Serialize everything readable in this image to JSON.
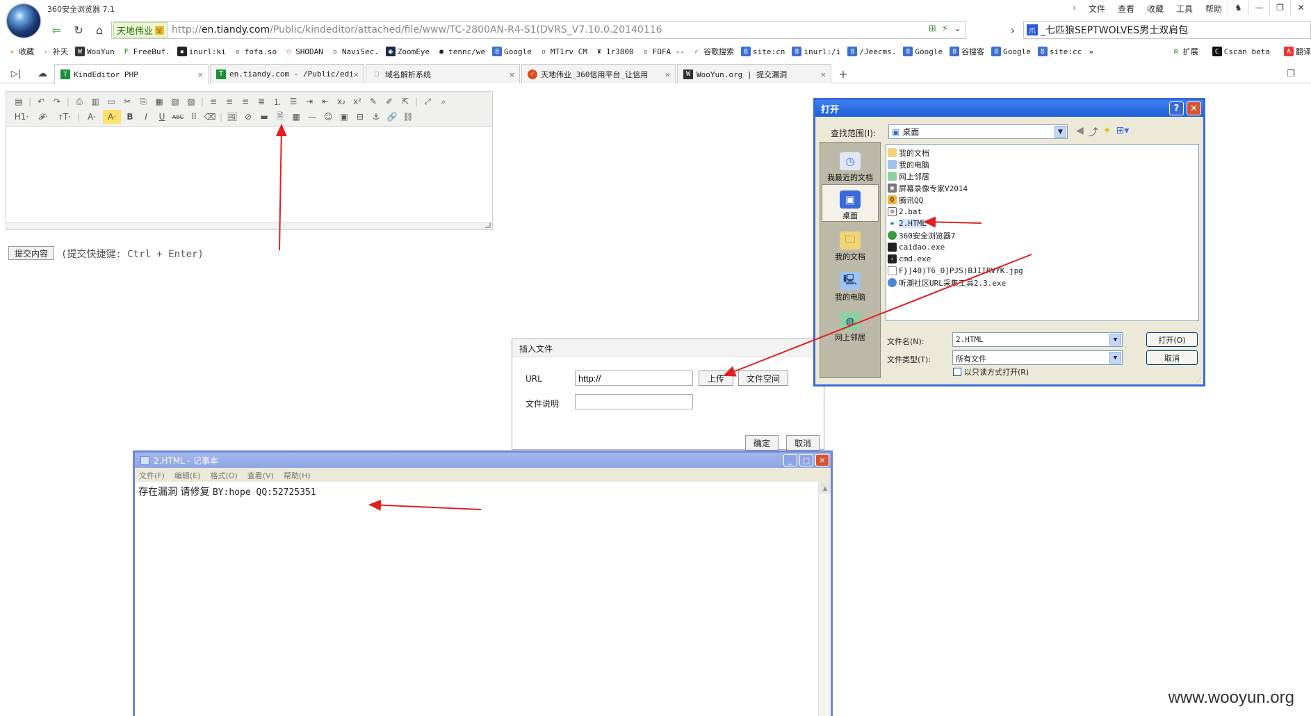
{
  "app": {
    "title": "360安全浏览器 7.1"
  },
  "menu": [
    "文件",
    "查看",
    "收藏",
    "工具",
    "帮助"
  ],
  "nav": {
    "site_badge": "天地伟业",
    "cert_label": "证",
    "url_host": "en.tiandy.com",
    "url_prefix": "http://",
    "url_path": "/Public/kindeditor/attached/file/www/TC-2800AN-R4-S1(DVRS_V7.10.0.20140116",
    "search_text": "_七匹狼SEPTWOLVES男士双肩包"
  },
  "bookmarks": [
    "收藏",
    "补天",
    "WooYun",
    "FreeBuf.",
    "inurl:ki",
    "fofa.so",
    "SHODAN",
    "NaviSec.",
    "ZoomEye",
    "tennc/we",
    "Google",
    "MT1rv CM",
    "1r3800",
    "FOFA --",
    "谷歌搜索",
    "site:cn",
    "inurl:/i",
    "/Jeecms.",
    "Google",
    "谷搜客",
    "Google",
    "site:cc"
  ],
  "bookmarks_right": [
    "扩展",
    "Cscan beta",
    "翻译"
  ],
  "tabs": [
    {
      "label": "KindEditor PHP",
      "icon": "T",
      "color": "#1a8f3a"
    },
    {
      "label": "en.tiandy.com - /Public/edi",
      "icon": "T",
      "color": "#1a8f3a"
    },
    {
      "label": "域名解析系统",
      "icon": "□",
      "color": "#999999"
    },
    {
      "label": "天地伟业_360信用平台_让信用",
      "icon": "✓",
      "color": "#e04b1a"
    },
    {
      "label": "WooYun.org | 提交漏洞",
      "icon": "W",
      "color": "#333333"
    }
  ],
  "editor": {
    "submit_label": "提交内容",
    "submit_hint": "(提交快捷键: Ctrl + Enter)"
  },
  "insert_dialog": {
    "title": "插入文件",
    "url_label": "URL",
    "url_value": "http://",
    "desc_label": "文件说明",
    "desc_value": "",
    "upload_label": "上传",
    "space_label": "文件空间",
    "ok_label": "确定",
    "cancel_label": "取消"
  },
  "open_dialog": {
    "title": "打开",
    "help_label": "?",
    "close_label": "✕",
    "lookin_label": "查找范围(I):",
    "lookin_value": "桌面",
    "places": [
      "我最近的文档",
      "桌面",
      "我的文档",
      "我的电脑",
      "网上邻居"
    ],
    "files": [
      {
        "name": "我的文档",
        "icon": "📁",
        "color": "#f1d478"
      },
      {
        "name": "我的电脑",
        "icon": "🖥",
        "color": "#9fc2ee"
      },
      {
        "name": "网上邻居",
        "icon": "🌐",
        "color": "#9fc2ee"
      },
      {
        "name": "屏幕录像专家V2014",
        "icon": "▣",
        "color": "#777777"
      },
      {
        "name": "腾讯QQ",
        "icon": "Q",
        "color": "#f2b43a"
      },
      {
        "name": "2.bat",
        "icon": "▪",
        "color": "#888888"
      },
      {
        "name": "2.HTML",
        "icon": "e",
        "color": "#6fb3ff"
      },
      {
        "name": "360安全浏览器7",
        "icon": "●",
        "color": "#3a9b3a"
      },
      {
        "name": "caidao.exe",
        "icon": "▮",
        "color": "#222222"
      },
      {
        "name": "cmd.exe",
        "icon": "▬",
        "color": "#222222"
      },
      {
        "name": "F}]40)T6_0]PJS)BJIIRVYK.jpg",
        "icon": "▤",
        "color": "#aaaaaa"
      },
      {
        "name": "听潮社区URL采集工具2.3.exe",
        "icon": "◉",
        "color": "#4a88d8"
      }
    ],
    "filename_label": "文件名(N):",
    "filename_value": "2.HTML",
    "filetype_label": "文件类型(T):",
    "filetype_value": "所有文件",
    "readonly_label": "以只读方式打开(R)",
    "open_label": "打开(O)",
    "cancel_label": "取消"
  },
  "notepad": {
    "title": "2.HTML - 记事本",
    "menu": [
      "文件(F)",
      "编辑(E)",
      "格式(O)",
      "查看(V)",
      "帮助(H)"
    ],
    "text_cn": "存在漏洞 请修复",
    "text_en": "BY:hope QQ:52725351"
  },
  "watermark": "www.wooyun.org",
  "colors": {
    "arrow": "#e02020",
    "xp_title": "#1f5ed6",
    "notepad_title": "#8ea4e4"
  }
}
